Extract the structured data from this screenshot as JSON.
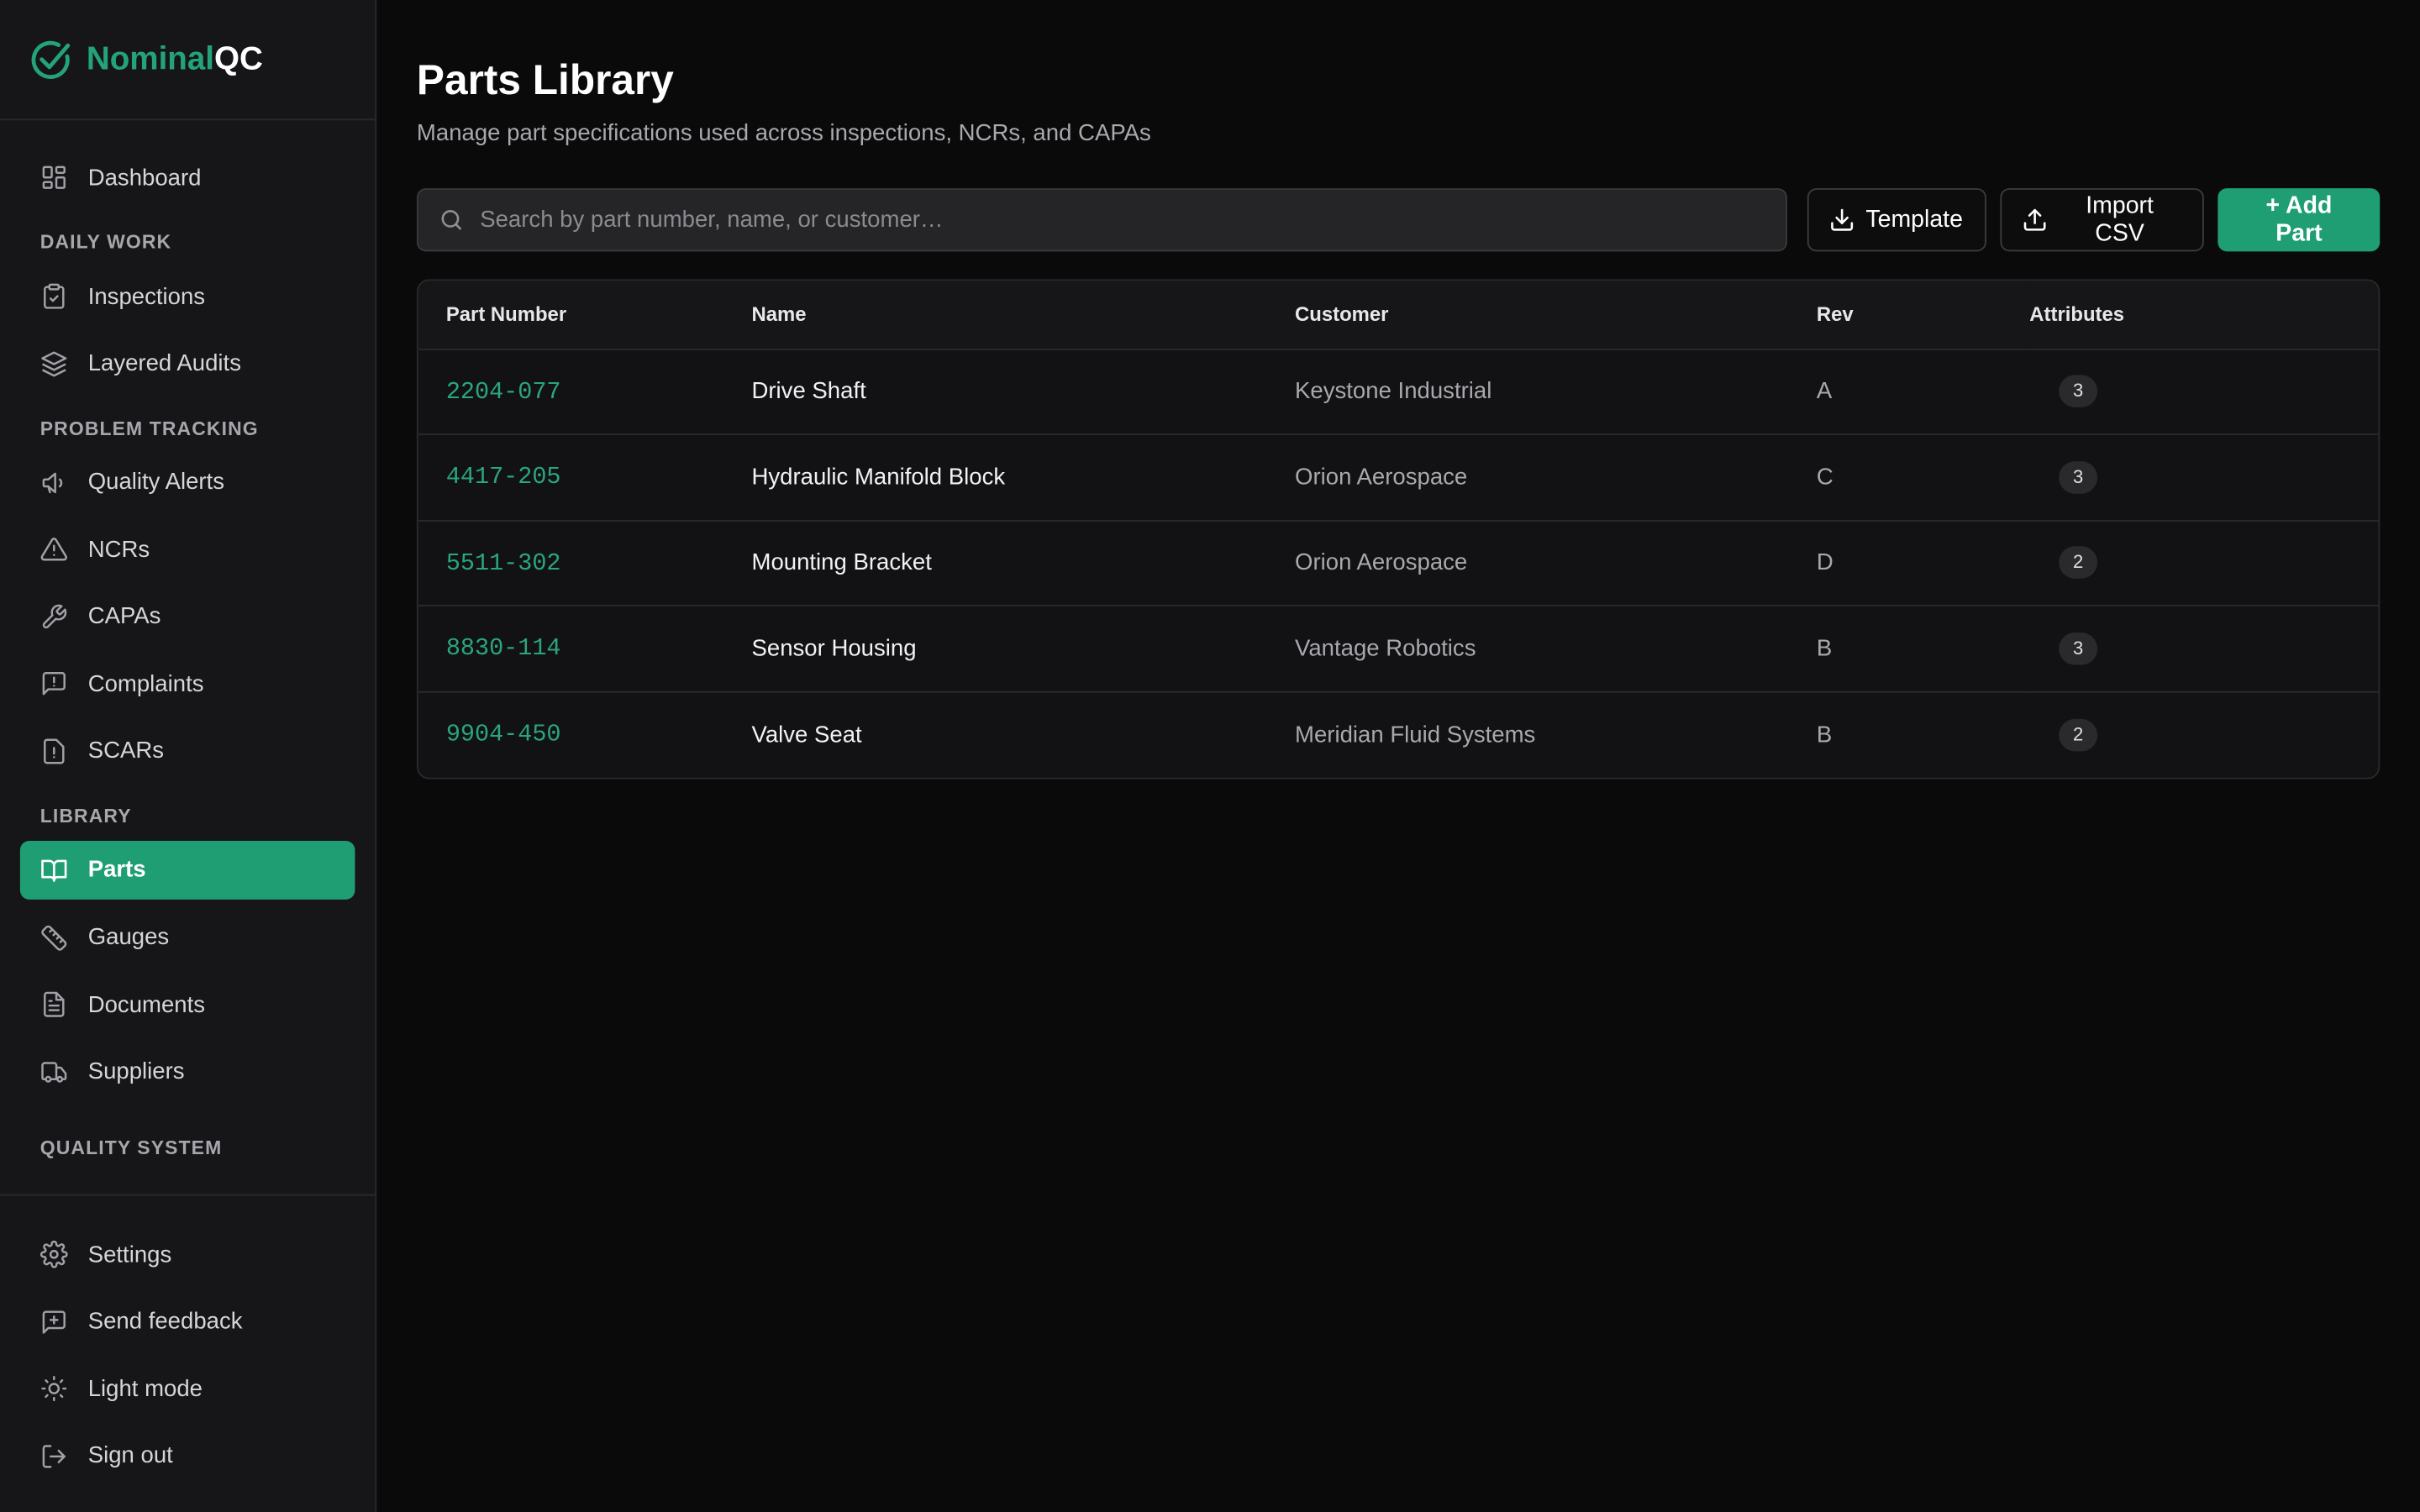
{
  "brand": {
    "name_part1": "Nominal",
    "name_part2": "QC"
  },
  "sidebar": {
    "dashboard": "Dashboard",
    "sections": {
      "daily_work": "DAILY WORK",
      "problem_tracking": "PROBLEM TRACKING",
      "library": "LIBRARY",
      "quality_system": "QUALITY SYSTEM"
    },
    "items": {
      "inspections": "Inspections",
      "layered_audits": "Layered Audits",
      "quality_alerts": "Quality Alerts",
      "ncrs": "NCRs",
      "capas": "CAPAs",
      "complaints": "Complaints",
      "scars": "SCARs",
      "parts": "Parts",
      "gauges": "Gauges",
      "documents": "Documents",
      "suppliers": "Suppliers"
    },
    "bottom": {
      "settings": "Settings",
      "send_feedback": "Send feedback",
      "light_mode": "Light mode",
      "sign_out": "Sign out"
    }
  },
  "page": {
    "title": "Parts Library",
    "subtitle": "Manage part specifications used across inspections, NCRs, and CAPAs"
  },
  "toolbar": {
    "search_placeholder": "Search by part number, name, or customer…",
    "template_label": "Template",
    "import_label": "Import CSV",
    "add_label": "+ Add Part"
  },
  "table": {
    "headers": {
      "part_number": "Part Number",
      "name": "Name",
      "customer": "Customer",
      "rev": "Rev",
      "attributes": "Attributes"
    },
    "rows": [
      {
        "part_number": "2204-077",
        "name": "Drive Shaft",
        "customer": "Keystone Industrial",
        "rev": "A",
        "attributes": "3"
      },
      {
        "part_number": "4417-205",
        "name": "Hydraulic Manifold Block",
        "customer": "Orion Aerospace",
        "rev": "C",
        "attributes": "3"
      },
      {
        "part_number": "5511-302",
        "name": "Mounting Bracket",
        "customer": "Orion Aerospace",
        "rev": "D",
        "attributes": "2"
      },
      {
        "part_number": "8830-114",
        "name": "Sensor Housing",
        "customer": "Vantage Robotics",
        "rev": "B",
        "attributes": "3"
      },
      {
        "part_number": "9904-450",
        "name": "Valve Seat",
        "customer": "Meridian Fluid Systems",
        "rev": "B",
        "attributes": "2"
      }
    ]
  },
  "colors": {
    "accent": "#1f9e74",
    "background": "#0a0a0b",
    "sidebar": "#161618"
  }
}
